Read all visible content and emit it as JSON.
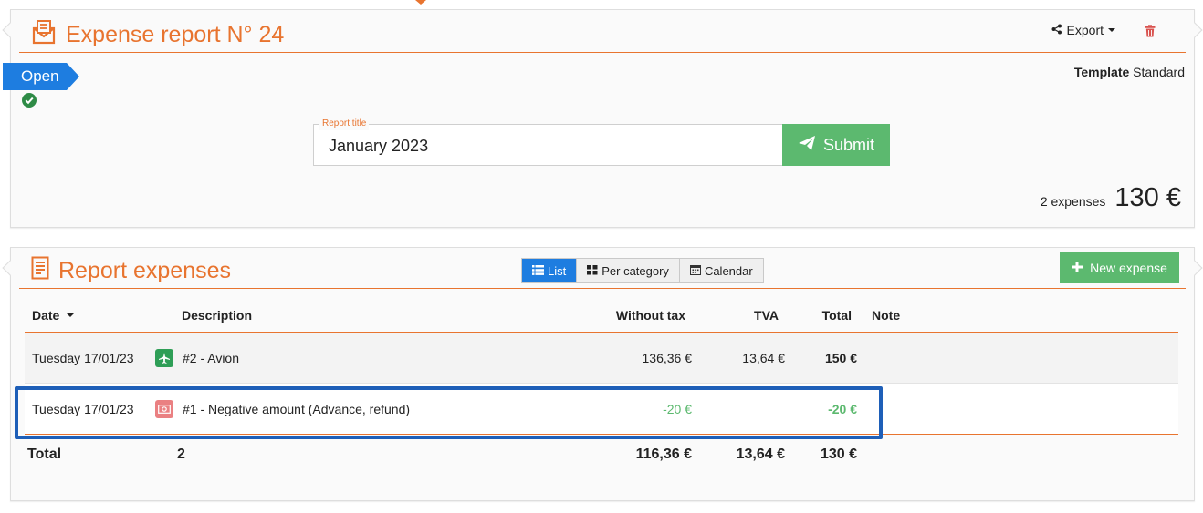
{
  "report": {
    "title": "Expense report N° 24",
    "export_label": "Export",
    "template_label": "Template",
    "template_value": "Standard",
    "status": "Open",
    "field_label": "Report title",
    "field_value": "January 2023",
    "submit_label": "Submit",
    "expense_count": "2 expenses",
    "total": "130 €"
  },
  "expenses": {
    "title": "Report expenses",
    "views": [
      "List",
      "Per category",
      "Calendar"
    ],
    "active_view": "List",
    "new_label": "New expense",
    "columns": {
      "date": "Date",
      "description": "Description",
      "without_tax": "Without tax",
      "tva": "TVA",
      "total": "Total",
      "note": "Note"
    },
    "rows": [
      {
        "date": "Tuesday 17/01/23",
        "icon": "plane-icon",
        "description": "#2 - Avion",
        "without_tax": "136,36 €",
        "tva": "13,64 €",
        "total": "150 €",
        "note": ""
      },
      {
        "date": "Tuesday 17/01/23",
        "icon": "banknote-icon",
        "description": "#1 - Negative amount (Advance, refund)",
        "without_tax": "-20 €",
        "tva": "",
        "total": "-20 €",
        "note": ""
      }
    ],
    "footer": {
      "label": "Total",
      "count": "2",
      "without_tax": "116,36 €",
      "tva": "13,64 €",
      "total": "130 €"
    }
  },
  "colors": {
    "accent": "#e8742f",
    "primary": "#1e7de0",
    "success": "#5cb96f",
    "highlight": "#1e5fb8"
  }
}
